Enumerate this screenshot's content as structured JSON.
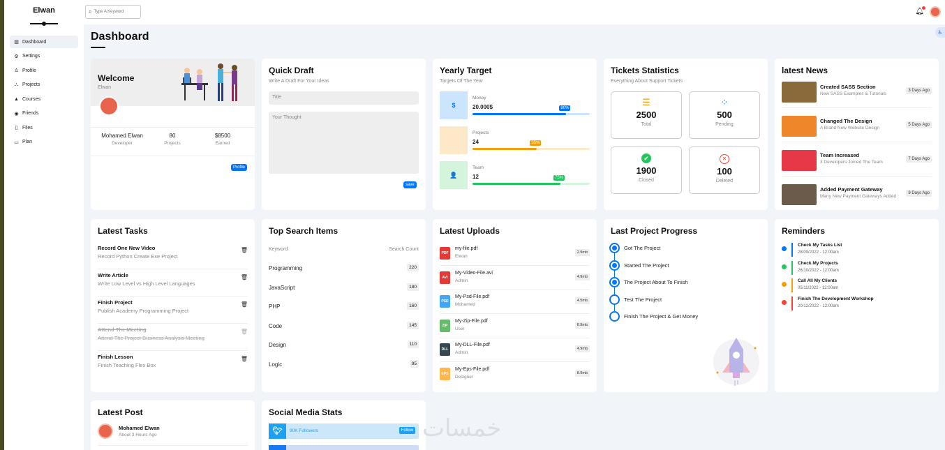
{
  "sidebar": {
    "brand": "Elwan",
    "items": [
      {
        "label": "Dashboard",
        "icon": "chart-bar-icon"
      },
      {
        "label": "Settings",
        "icon": "gear-icon"
      },
      {
        "label": "Profile",
        "icon": "user-icon"
      },
      {
        "label": "Projects",
        "icon": "diagram-icon"
      },
      {
        "label": "Courses",
        "icon": "graduation-cap-icon"
      },
      {
        "label": "Friends",
        "icon": "circle-user-icon"
      },
      {
        "label": "Files",
        "icon": "file-icon"
      },
      {
        "label": "Plan",
        "icon": "credit-card-icon"
      }
    ]
  },
  "topbar": {
    "search_placeholder": "Type A Keyword"
  },
  "page_title": "Dashboard",
  "welcome": {
    "title": "Welcome",
    "name": "Elwan",
    "user_name": "Mohamed Elwan",
    "user_role": "Developer",
    "projects_count": "80",
    "projects_label": "Projects",
    "earned": "$8500",
    "earned_label": "Earned",
    "button": "Profile"
  },
  "quick_draft": {
    "title": "Quick Draft",
    "subtitle": "Write A Draft For Your Ideas",
    "title_placeholder": "Title",
    "thought_placeholder": "Your Thought",
    "button": "save"
  },
  "yearly_target": {
    "title": "Yearly Target",
    "subtitle": "Targets Of The Year",
    "items": [
      {
        "label": "Money",
        "value": "20.000$",
        "percent": "80%",
        "fraction": 0.8,
        "color": "#0075ff",
        "bg": "#cce5ff",
        "icon": "$"
      },
      {
        "label": "Projects",
        "value": "24",
        "percent": "55%",
        "fraction": 0.55,
        "color": "#f59e0b",
        "bg": "#fde9c7",
        "icon": "</>"
      },
      {
        "label": "Team",
        "value": "12",
        "percent": "75%",
        "fraction": 0.75,
        "color": "#22c55e",
        "bg": "#d4f4dc",
        "icon": "&#128100;"
      }
    ]
  },
  "tickets": {
    "title": "Tickets Statistics",
    "subtitle": "Everything About Support Tickets",
    "items": [
      {
        "value": "2500",
        "label": "Total",
        "color": "#f59e0b",
        "icon": "☰"
      },
      {
        "value": "500",
        "label": "Pending",
        "color": "#0075ff",
        "icon": "⁘"
      },
      {
        "value": "1900",
        "label": "Closed",
        "color": "#22c55e",
        "icon": "✔"
      },
      {
        "value": "100",
        "label": "Deleted",
        "color": "#f44336",
        "icon": "⊗"
      }
    ]
  },
  "news": {
    "title": "latest News",
    "items": [
      {
        "title": "Created SASS Section",
        "desc": "New SASS Examples & Tutorials",
        "time": "3 Days Ago",
        "color": "#8a6a3a"
      },
      {
        "title": "Changed The Design",
        "desc": "A Brand New Website Design",
        "time": "5 Days Ago",
        "color": "#f0862a"
      },
      {
        "title": "Team Increased",
        "desc": "3 Developers Joined The Team",
        "time": "7 Days Ago",
        "color": "#e63946"
      },
      {
        "title": "Added Payment Gateway",
        "desc": "Many New Payment Gateways Added",
        "time": "9 Days Ago",
        "color": "#6b5b4a"
      }
    ]
  },
  "tasks": {
    "title": "Latest Tasks",
    "items": [
      {
        "title": "Record One New Video",
        "desc": "Record Python Create Exe Project",
        "done": false
      },
      {
        "title": "Write Article",
        "desc": "Write Low Level vs High Level Languages",
        "done": false
      },
      {
        "title": "Finish Project",
        "desc": "Publish Academy Programming Project",
        "done": false
      },
      {
        "title": "Attend The Meeting",
        "desc": "Attend The Project Business Analysis Meeting",
        "done": true
      },
      {
        "title": "Finish Lesson",
        "desc": "Finish Teaching Flex Box",
        "done": false
      }
    ]
  },
  "top_search": {
    "title": "Top Search Items",
    "col_keyword": "Keyword",
    "col_count": "Search Count",
    "items": [
      {
        "keyword": "Programming",
        "count": "220"
      },
      {
        "keyword": "JavaScript",
        "count": "180"
      },
      {
        "keyword": "PHP",
        "count": "160"
      },
      {
        "keyword": "Code",
        "count": "145"
      },
      {
        "keyword": "Design",
        "count": "110"
      },
      {
        "keyword": "Logic",
        "count": "95"
      }
    ]
  },
  "uploads": {
    "title": "Latest Uploads",
    "items": [
      {
        "name": "my-file.pdf",
        "user": "Elwan",
        "size": "2.9mb",
        "type": "PDF",
        "color": "#e53935"
      },
      {
        "name": "My-Video-File.avi",
        "user": "Admin",
        "size": "4.9mb",
        "type": "AVI",
        "color": "#e53935"
      },
      {
        "name": "My-Psd-File.pdf",
        "user": "Mohamed",
        "size": "4.5mb",
        "type": "PSD",
        "color": "#42a5f5"
      },
      {
        "name": "My-Zip-File.pdf",
        "user": "User",
        "size": "8.9mb",
        "type": "ZIP",
        "color": "#66bb6a"
      },
      {
        "name": "My-DLL-File.pdf",
        "user": "Admin",
        "size": "4.9mb",
        "type": "DLL",
        "color": "#37474f"
      },
      {
        "name": "My-Eps-File.pdf",
        "user": "Designer",
        "size": "8.9mb",
        "type": "EPS",
        "color": "#ffb74d"
      }
    ]
  },
  "project_progress": {
    "title": "Last Project Progress",
    "steps": [
      {
        "label": "Got The Project",
        "done": true
      },
      {
        "label": "Started The Project",
        "done": true
      },
      {
        "label": "The Project About To Finish",
        "done": true
      },
      {
        "label": "Test The Project",
        "done": false
      },
      {
        "label": "Finish The Project & Get Money",
        "done": false
      }
    ]
  },
  "reminders": {
    "title": "Reminders",
    "items": [
      {
        "title": "Check My Tasks List",
        "date": "28/09/2022 - 12:00am",
        "color": "#0075ff"
      },
      {
        "title": "Check My Projects",
        "date": "26/10/2022 - 12:00am",
        "color": "#22c55e"
      },
      {
        "title": "Call All My Clients",
        "date": "05/11/2022 - 12:00am",
        "color": "#f59e0b"
      },
      {
        "title": "Finish The Development Workshop",
        "date": "20/12/2022 - 12:00am",
        "color": "#f44336"
      }
    ]
  },
  "latest_post": {
    "title": "Latest Post",
    "author": "Mohamed Elwan",
    "time": "About 3 Hours Ago"
  },
  "social": {
    "title": "Social Media Stats",
    "items": [
      {
        "label": "90K Followers",
        "button": "Follow"
      }
    ]
  },
  "watermark": "خمسات"
}
